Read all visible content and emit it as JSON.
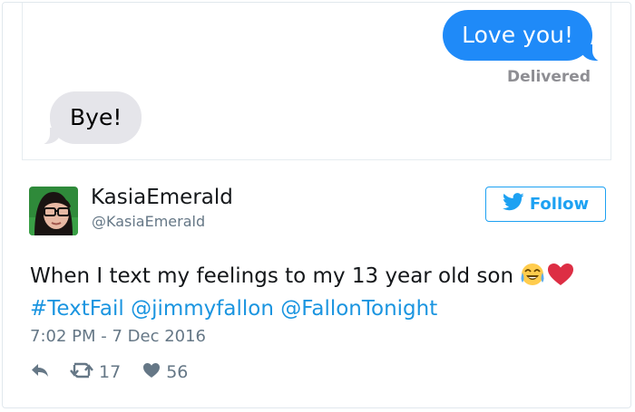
{
  "conversation": {
    "outgoing_message": "Love you!",
    "status": "Delivered",
    "incoming_message": "Bye!"
  },
  "author": {
    "display_name": "KasiaEmerald",
    "handle": "@KasiaEmerald"
  },
  "follow_button": {
    "label": "Follow"
  },
  "tweet": {
    "text": "When I text my feelings to my 13 year old son",
    "hashtag": "#TextFail",
    "mention_1": "@jimmyfallon",
    "mention_2": "@FallonTonight",
    "timestamp": "7:02 PM - 7 Dec 2016"
  },
  "actions": {
    "retweet_count": "17",
    "like_count": "56"
  },
  "icons": [
    "reply-icon",
    "retweet-icon",
    "like-icon",
    "twitter-bird-icon",
    "joy-emoji",
    "red-heart-emoji"
  ],
  "colors": {
    "imessage_blue": "#1f8af8",
    "imessage_gray": "#e5e5ea",
    "twitter_blue": "#1da1f2",
    "link_blue": "#1b95e0",
    "muted": "#657786"
  }
}
